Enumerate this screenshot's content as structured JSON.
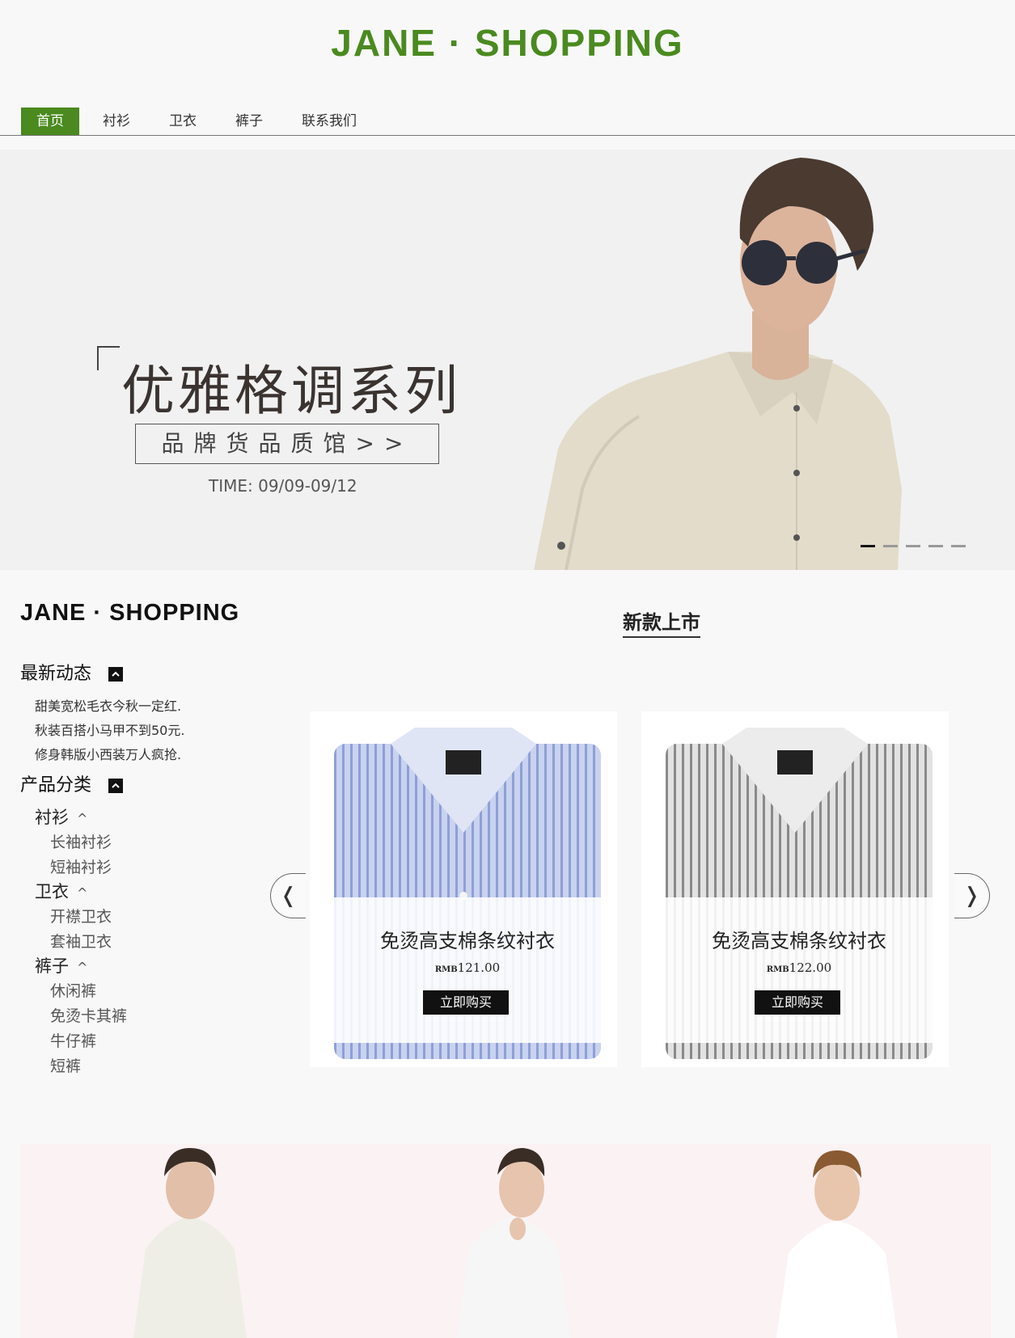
{
  "header": {
    "logo": "JANE · SHOPPING"
  },
  "nav": {
    "items": [
      {
        "label": "首页",
        "active": true
      },
      {
        "label": "衬衫",
        "active": false
      },
      {
        "label": "卫衣",
        "active": false
      },
      {
        "label": "裤子",
        "active": false
      },
      {
        "label": "联系我们",
        "active": false
      }
    ]
  },
  "banner": {
    "title": "优雅格调系列",
    "button_label": "品牌货品质馆>>",
    "time": "TIME: 09/09-09/12",
    "slide_count": 5,
    "active_slide": 1
  },
  "sidebar": {
    "logo": "JANE · SHOPPING",
    "news_heading": "最新动态",
    "news": [
      "甜美宽松毛衣今秋一定红.",
      "秋装百搭小马甲不到50元.",
      "修身韩版小西装万人疯抢."
    ],
    "category_heading": "产品分类",
    "categories": [
      {
        "name": "衬衫",
        "subs": [
          "长袖衬衫",
          "短袖衬衫"
        ]
      },
      {
        "name": "卫衣",
        "subs": [
          "开襟卫衣",
          "套袖卫衣"
        ]
      },
      {
        "name": "裤子",
        "subs": [
          "休闲裤",
          "免烫卡其裤",
          "牛仔裤",
          "短裤"
        ]
      }
    ]
  },
  "new_arrivals": {
    "title": "新款上市",
    "products": [
      {
        "name": "免烫高支棉条纹衬衣",
        "currency": "RMB",
        "price": "121.00",
        "buy_label": "立即购买",
        "color": "blue"
      },
      {
        "name": "免烫高支棉条纹衬衣",
        "currency": "RMB",
        "price": "122.00",
        "buy_label": "立即购买",
        "color": "grey"
      }
    ],
    "prev_arrow": "❬",
    "next_arrow": "❭"
  },
  "colors": {
    "brand_green": "#4a8a1f",
    "button_black": "#111111"
  }
}
